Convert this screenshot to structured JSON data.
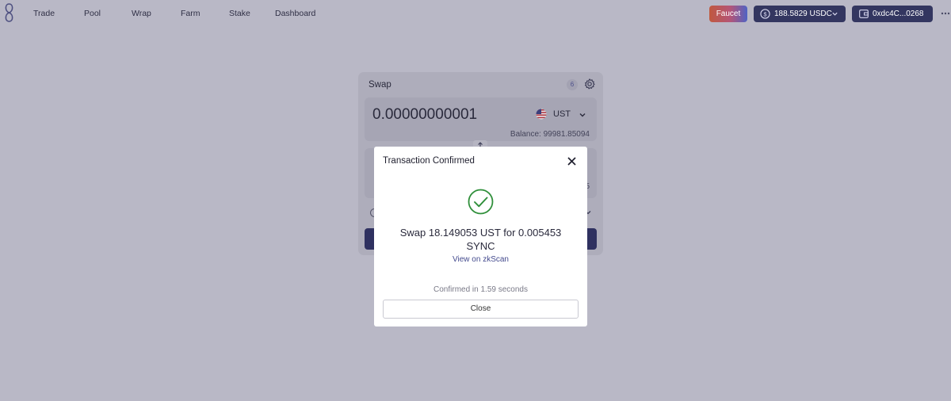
{
  "header": {
    "nav": [
      "Trade",
      "Pool",
      "Wrap",
      "Farm",
      "Stake",
      "Dashboard"
    ],
    "faucet_label": "Faucet",
    "balance_amount": "188.5829",
    "balance_token": "USDC",
    "account_address": "0xdc4C...0268"
  },
  "swap": {
    "title": "Swap",
    "pending_count": "6",
    "from_amount": "0.00000000001",
    "from_token": "UST",
    "balance_text": "Balance: 99981.85094",
    "output_partial": "5"
  },
  "modal": {
    "title": "Transaction Confirmed",
    "message_line1": "Swap 18.149053 UST for 0.005453",
    "message_line2": "SYNC",
    "link_text": "View on zkScan",
    "confirmed_text": "Confirmed in 1.59 seconds",
    "close_label": "Close"
  },
  "colors": {
    "overlay_bg": "#b9b8c6",
    "nav_button": "#333660",
    "success_green": "#2f8f3a",
    "link": "#444b8e"
  },
  "icons": [
    "logo-icon",
    "coin-icon",
    "chevron-down-icon",
    "wallet-icon",
    "more-icon",
    "gear-icon",
    "flag-icon",
    "swap-arrow-icon",
    "close-icon",
    "check-circle-icon"
  ]
}
